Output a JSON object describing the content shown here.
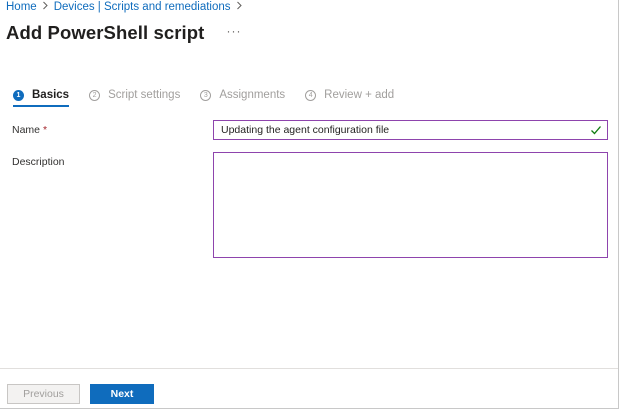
{
  "breadcrumb": {
    "items": [
      "Home",
      "Devices | Scripts and remediations"
    ],
    "separator": ">"
  },
  "header": {
    "title": "Add PowerShell script",
    "more": "···"
  },
  "wizard": {
    "steps": [
      {
        "number": "1",
        "label": "Basics",
        "state": "active"
      },
      {
        "number": "2",
        "label": "Script settings",
        "state": "inactive"
      },
      {
        "number": "3",
        "label": "Assignments",
        "state": "inactive"
      },
      {
        "number": "4",
        "label": "Review + add",
        "state": "inactive"
      }
    ]
  },
  "form": {
    "name_label": "Name",
    "required_marker": "*",
    "name_value": "Updating the agent configuration file",
    "description_label": "Description",
    "description_value": ""
  },
  "footer": {
    "previous_label": "Previous",
    "next_label": "Next"
  },
  "colors": {
    "accent": "#0f6cbd",
    "input_border": "#8e44ad",
    "valid_check": "#107c10",
    "required": "#a4262c"
  },
  "icons": {
    "valid": "check-icon",
    "separator": "chevron-right-icon",
    "more": "ellipsis-icon"
  }
}
